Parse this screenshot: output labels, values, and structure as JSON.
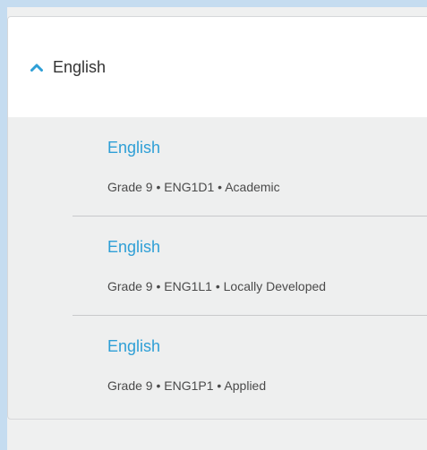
{
  "section": {
    "title": "English",
    "expanded": true,
    "icon": "chevron-up-icon",
    "accent_color": "#2e9fd6"
  },
  "courses": [
    {
      "title": "English",
      "meta": "Grade 9 • ENG1D1 • Academic"
    },
    {
      "title": "English",
      "meta": "Grade 9 • ENG1L1 • Locally Developed"
    },
    {
      "title": "English",
      "meta": "Grade 9 • ENG1P1 • Applied"
    }
  ]
}
